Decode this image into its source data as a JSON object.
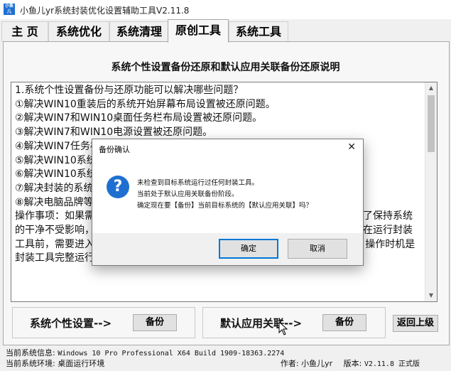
{
  "window": {
    "title": "小鱼儿yr系统封装优化设置辅助工具V2.11.8",
    "icon_text": "小鱼儿"
  },
  "tabs": [
    {
      "label": "主 页"
    },
    {
      "label": "系统优化"
    },
    {
      "label": "系统清理"
    },
    {
      "label": "原创工具",
      "active": true
    },
    {
      "label": "系统工具"
    }
  ],
  "main": {
    "section_title": "系统个性设置备份还原和默认应用关联备份还原说明",
    "description": "1.系统个性设置备份与还原功能可以解决哪些问题？\n①解决WIN10重装后的系统开始屏幕布局设置被还原问题。\n②解决WIN7和WIN10桌面任务栏布局设置被还原问题。\n③解决WIN7和WIN10电源设置被还原问题。\n④解决WIN7任务栏及资源管理器等个性设置被还原的问题。\n⑤解决WIN10系统中默认应用关联等被还原的问题。\n⑥解决WIN10系统中默认应用关联设置及其他个性化设置被还原的问题。\n⑦解决封装的系统中其他个性设置被还原的问题。\n⑧解决电脑品牌等OEM信息被还原的问题。\n操作事项：如果需要对系统进行个性化设置，同时为了保持系统的干净，所以为了保持系统的干净不受影响，本功能分为两个阶段，第一阶段是备份当前系统的个性设置，在运行封装工具前，需要进入PE里，执行备份操作。第二阶段是还原之前备份的个性设置。操作时机是封装工具完整运行结束后，准备打包镜像前，执行还原操作。至于备"
  },
  "bottom": {
    "personal_label": "系统个性设置-->",
    "personal_button": "备份",
    "assoc_label": "默认应用关联-->",
    "assoc_button": "备份",
    "return_button": "返回上级"
  },
  "status": {
    "sysinfo_label": "当前系统信息:",
    "sysinfo_value": "Windows 10 Pro Professional X64 Build 1909-18363.2274",
    "env_label": "当前系统环境:",
    "env_value": "桌面运行环境",
    "author_label": "作者:",
    "author_value": "小鱼儿yr",
    "version_label": "版本:",
    "version_value": "V2.11.8 正式版"
  },
  "dialog": {
    "title": "备份确认",
    "close": "✕",
    "icon": "?",
    "lines": [
      "未检查到目标系统运行过任何封装工具。",
      "当前处于默认应用关联备份阶段。",
      "确定现在要【备份】当前目标系统的【默认应用关联】吗？"
    ],
    "ok": "确定",
    "cancel": "取消"
  }
}
